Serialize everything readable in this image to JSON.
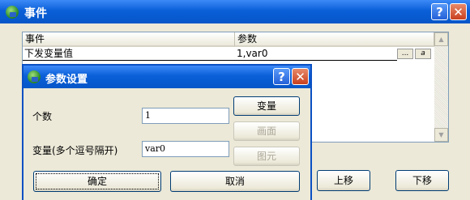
{
  "window": {
    "title": "事件",
    "help": "?",
    "close": "✕"
  },
  "list": {
    "columns": [
      "事件",
      "参数"
    ],
    "rows": [
      {
        "event": "下发变量值",
        "param": "1,var0",
        "btn1": "...",
        "btn2": "a"
      }
    ]
  },
  "main_buttons": {
    "up": "上移",
    "down": "下移"
  },
  "dialog": {
    "title": "参数设置",
    "help": "?",
    "close": "✕",
    "count_label": "个数",
    "count_value": "1",
    "var_label": "变量(多个逗号隔开)",
    "var_value": "var0",
    "btn_variable": "变量",
    "btn_screen": "画面",
    "btn_element": "图元",
    "ok": "确定",
    "cancel": "取消"
  },
  "scroll": {
    "up": "▲",
    "down": "▼"
  }
}
